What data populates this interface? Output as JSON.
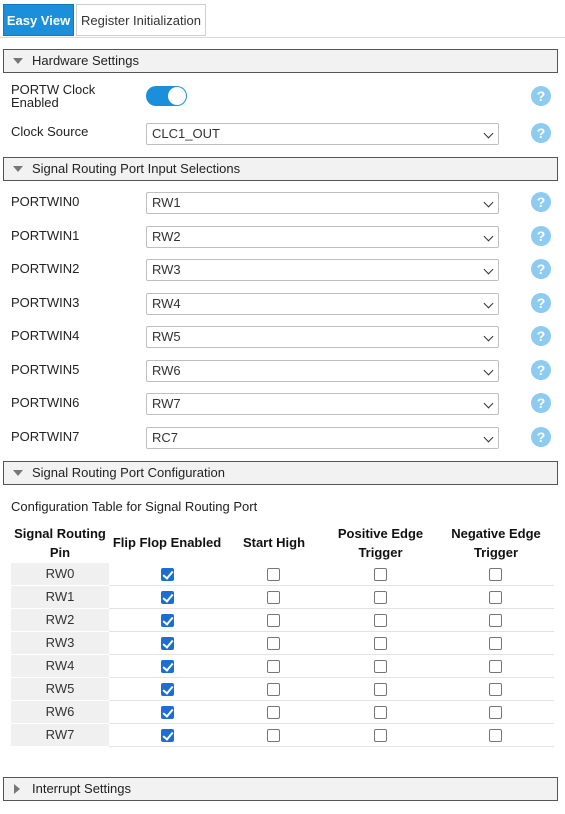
{
  "tabs": [
    {
      "label": "Easy View",
      "active": true
    },
    {
      "label": "Register Initialization",
      "active": false
    }
  ],
  "sections": {
    "hardware": "Hardware Settings",
    "routing_inputs": "Signal Routing Port Input Selections",
    "routing_config": "Signal Routing Port Configuration",
    "interrupt": "Interrupt Settings"
  },
  "hardware": {
    "clock_enabled_label_line1": "PORTW Clock",
    "clock_enabled_label_line2": "Enabled",
    "clock_enabled": true,
    "clock_source_label": "Clock Source",
    "clock_source_value": "CLC1_OUT"
  },
  "inputs": [
    {
      "label": "PORTWIN0",
      "value": "RW1"
    },
    {
      "label": "PORTWIN1",
      "value": "RW2"
    },
    {
      "label": "PORTWIN2",
      "value": "RW3"
    },
    {
      "label": "PORTWIN3",
      "value": "RW4"
    },
    {
      "label": "PORTWIN4",
      "value": "RW5"
    },
    {
      "label": "PORTWIN5",
      "value": "RW6"
    },
    {
      "label": "PORTWIN6",
      "value": "RW7"
    },
    {
      "label": "PORTWIN7",
      "value": "RC7"
    }
  ],
  "help_glyph": "?",
  "config_table": {
    "caption": "Configuration Table for Signal Routing Port",
    "headers": {
      "pin_l1": "Signal Routing",
      "pin_l2": "Pin",
      "ff": "Flip Flop Enabled",
      "start": "Start High",
      "pos_l1": "Positive Edge",
      "pos_l2": "Trigger",
      "neg_l1": "Negative Edge",
      "neg_l2": "Trigger"
    },
    "rows": [
      {
        "pin": "RW0",
        "ff": true,
        "start": false,
        "pos": false,
        "neg": false
      },
      {
        "pin": "RW1",
        "ff": true,
        "start": false,
        "pos": false,
        "neg": false
      },
      {
        "pin": "RW2",
        "ff": true,
        "start": false,
        "pos": false,
        "neg": false
      },
      {
        "pin": "RW3",
        "ff": true,
        "start": false,
        "pos": false,
        "neg": false
      },
      {
        "pin": "RW4",
        "ff": true,
        "start": false,
        "pos": false,
        "neg": false
      },
      {
        "pin": "RW5",
        "ff": true,
        "start": false,
        "pos": false,
        "neg": false
      },
      {
        "pin": "RW6",
        "ff": true,
        "start": false,
        "pos": false,
        "neg": false
      },
      {
        "pin": "RW7",
        "ff": true,
        "start": false,
        "pos": false,
        "neg": false
      }
    ]
  },
  "colors": {
    "accent": "#1b8fd9",
    "help": "#8ecbf0",
    "checkbox_on": "#1b6fd1"
  }
}
